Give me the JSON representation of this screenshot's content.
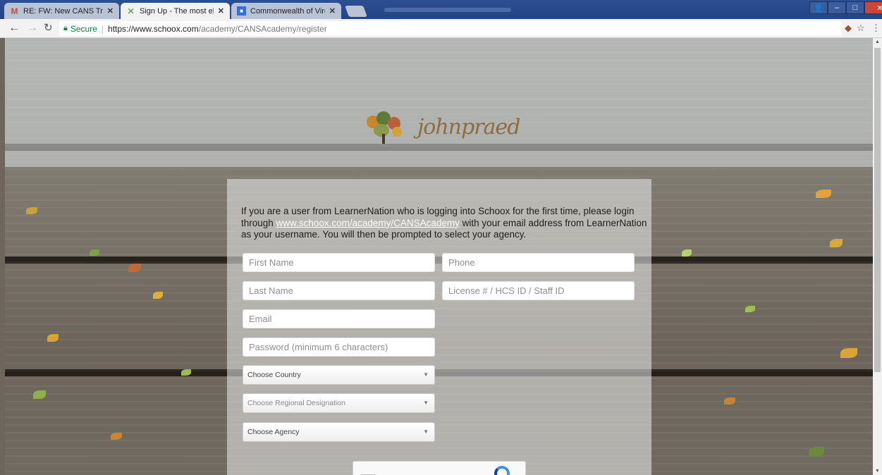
{
  "browser": {
    "tabs": [
      {
        "title": "RE: FW: New CANS Traini",
        "icon": "gmail-icon",
        "active": false
      },
      {
        "title": "Sign Up - The most elega",
        "icon": "schoox-icon",
        "active": true
      },
      {
        "title": "Commonwealth of Virgin",
        "icon": "doc-icon",
        "active": false
      }
    ],
    "secure_label": "Secure",
    "url_host": "https://www.schoox.com",
    "url_path": "/academy/CANSAcademy/register"
  },
  "header": {
    "logo_text": "johnpraed"
  },
  "form": {
    "intro_before": "If you are a user from LearnerNation who is logging into Schoox for the first time, please login through ",
    "intro_link": "www.schoox.com/academy/CANSAcademy",
    "intro_after": " with your email address from LearnerNation as your username. You will then be prompted to select your agency.",
    "first_name_placeholder": "First Name",
    "phone_placeholder": "Phone",
    "last_name_placeholder": "Last Name",
    "license_placeholder": "License # / HCS ID / Staff ID",
    "email_placeholder": "Email",
    "password_placeholder": "Password (minimum 6 characters)",
    "country_select": "Choose Country",
    "region_select": "Choose Regional Designation",
    "agency_select": "Choose Agency"
  },
  "colors": {
    "accent_green": "#0b8043",
    "chrome_blue": "#2c4f92"
  }
}
